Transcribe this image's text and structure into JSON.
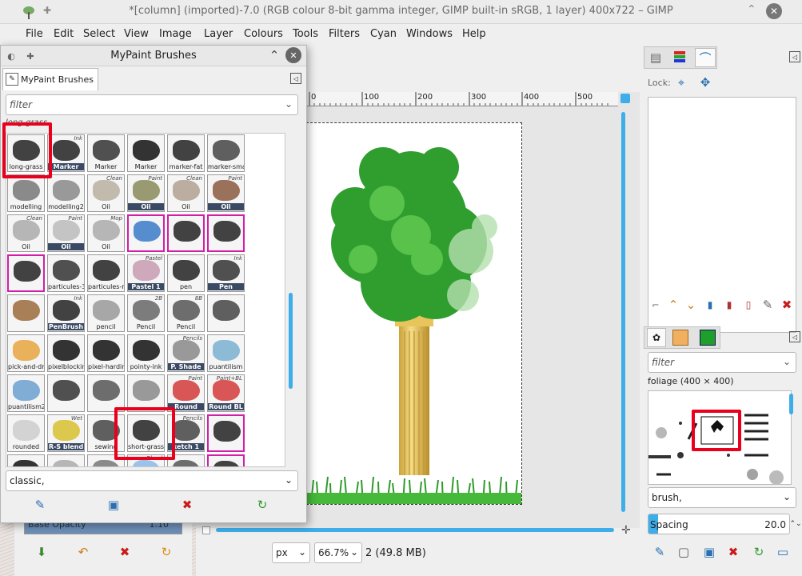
{
  "window": {
    "title": "*[column] (imported)-7.0 (RGB colour 8-bit gamma integer, GIMP built-in sRGB, 1 layer) 400x722 – GIMP"
  },
  "menu": [
    "File",
    "Edit",
    "Select",
    "View",
    "Image",
    "Layer",
    "Colours",
    "Tools",
    "Filters",
    "Cyan",
    "Windows",
    "Help"
  ],
  "ruler": {
    "ticks": [
      "0",
      "100",
      "200",
      "300",
      "400",
      "500"
    ]
  },
  "status": {
    "unit": "px",
    "zoom": "66.7%",
    "info": "2 (49.8 MB)"
  },
  "dock": {
    "lock_label": "Lock:",
    "brushes_filter_placeholder": "filter",
    "brush_name": "foliage (400 × 400)",
    "brush_tag": "brush,",
    "spacing_label": "Spacing",
    "spacing_value": "20.0"
  },
  "dialog": {
    "title": "MyPaint Brushes",
    "tab_label": "MyPaint Brushes",
    "filter_placeholder": "filter",
    "selected": "long-grass",
    "tag_value": "classic,",
    "brushes": [
      {
        "label": "long-grass",
        "tag": ""
      },
      {
        "label": "Marker",
        "tag": "Ink"
      },
      {
        "label": "Marker",
        "tag": ""
      },
      {
        "label": "Marker",
        "tag": ""
      },
      {
        "label": "marker-fat",
        "tag": ""
      },
      {
        "label": "marker-small",
        "tag": ""
      },
      {
        "label": "modelling",
        "tag": ""
      },
      {
        "label": "modelling2",
        "tag": ""
      },
      {
        "label": "Oil",
        "tag": "Clean"
      },
      {
        "label": "Oil",
        "tag": "Paint"
      },
      {
        "label": "Oil",
        "tag": "Clean"
      },
      {
        "label": "Oil",
        "tag": "Paint"
      },
      {
        "label": "Oil",
        "tag": "Clean"
      },
      {
        "label": "Oil",
        "tag": "Paint"
      },
      {
        "label": "Oil",
        "tag": "Mop"
      },
      {
        "label": "",
        "tag": ""
      },
      {
        "label": "",
        "tag": ""
      },
      {
        "label": "",
        "tag": ""
      },
      {
        "label": "",
        "tag": ""
      },
      {
        "label": "particules-3",
        "tag": ""
      },
      {
        "label": "particules-ren",
        "tag": ""
      },
      {
        "label": "Pastel 1",
        "tag": "Pastel"
      },
      {
        "label": "pen",
        "tag": ""
      },
      {
        "label": "Pen",
        "tag": "Ink"
      },
      {
        "label": "",
        "tag": ""
      },
      {
        "label": "PenBrush",
        "tag": "Ink"
      },
      {
        "label": "pencil",
        "tag": ""
      },
      {
        "label": "Pencil",
        "tag": "2B"
      },
      {
        "label": "Pencil",
        "tag": "8B"
      },
      {
        "label": "",
        "tag": ""
      },
      {
        "label": "pick-and-drag",
        "tag": ""
      },
      {
        "label": "pixelblocking",
        "tag": ""
      },
      {
        "label": "pixel-hardink",
        "tag": ""
      },
      {
        "label": "pointy-ink",
        "tag": ""
      },
      {
        "label": "P. Shade",
        "tag": "Pencils"
      },
      {
        "label": "puantilism",
        "tag": ""
      },
      {
        "label": "puantilism2",
        "tag": ""
      },
      {
        "label": "",
        "tag": ""
      },
      {
        "label": "",
        "tag": ""
      },
      {
        "label": "",
        "tag": ""
      },
      {
        "label": "Round",
        "tag": "Paint"
      },
      {
        "label": "Round BL",
        "tag": "Paint+BL"
      },
      {
        "label": "rounded",
        "tag": ""
      },
      {
        "label": "R-S blend",
        "tag": "Wet"
      },
      {
        "label": "sewing",
        "tag": ""
      },
      {
        "label": "short-grass",
        "tag": ""
      },
      {
        "label": "ketch 1",
        "tag": "Pencils"
      },
      {
        "label": "",
        "tag": ""
      },
      {
        "label": "",
        "tag": ""
      },
      {
        "label": "",
        "tag": ""
      },
      {
        "label": "",
        "tag": ""
      },
      {
        "label": "",
        "tag": "Blend"
      },
      {
        "label": "",
        "tag": ""
      },
      {
        "label": "",
        "tag": ""
      }
    ]
  },
  "below_dialog": {
    "opacity_label": "Base Opacity",
    "opacity_value": "1.10"
  }
}
